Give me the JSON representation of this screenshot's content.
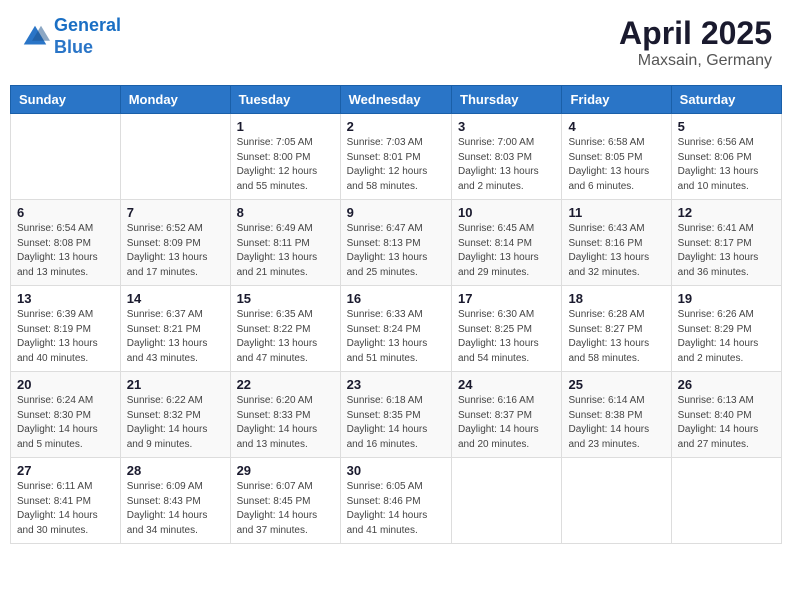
{
  "header": {
    "logo_line1": "General",
    "logo_line2": "Blue",
    "month": "April 2025",
    "location": "Maxsain, Germany"
  },
  "weekdays": [
    "Sunday",
    "Monday",
    "Tuesday",
    "Wednesday",
    "Thursday",
    "Friday",
    "Saturday"
  ],
  "weeks": [
    [
      {
        "day": "",
        "info": ""
      },
      {
        "day": "",
        "info": ""
      },
      {
        "day": "1",
        "info": "Sunrise: 7:05 AM\nSunset: 8:00 PM\nDaylight: 12 hours\nand 55 minutes."
      },
      {
        "day": "2",
        "info": "Sunrise: 7:03 AM\nSunset: 8:01 PM\nDaylight: 12 hours\nand 58 minutes."
      },
      {
        "day": "3",
        "info": "Sunrise: 7:00 AM\nSunset: 8:03 PM\nDaylight: 13 hours\nand 2 minutes."
      },
      {
        "day": "4",
        "info": "Sunrise: 6:58 AM\nSunset: 8:05 PM\nDaylight: 13 hours\nand 6 minutes."
      },
      {
        "day": "5",
        "info": "Sunrise: 6:56 AM\nSunset: 8:06 PM\nDaylight: 13 hours\nand 10 minutes."
      }
    ],
    [
      {
        "day": "6",
        "info": "Sunrise: 6:54 AM\nSunset: 8:08 PM\nDaylight: 13 hours\nand 13 minutes."
      },
      {
        "day": "7",
        "info": "Sunrise: 6:52 AM\nSunset: 8:09 PM\nDaylight: 13 hours\nand 17 minutes."
      },
      {
        "day": "8",
        "info": "Sunrise: 6:49 AM\nSunset: 8:11 PM\nDaylight: 13 hours\nand 21 minutes."
      },
      {
        "day": "9",
        "info": "Sunrise: 6:47 AM\nSunset: 8:13 PM\nDaylight: 13 hours\nand 25 minutes."
      },
      {
        "day": "10",
        "info": "Sunrise: 6:45 AM\nSunset: 8:14 PM\nDaylight: 13 hours\nand 29 minutes."
      },
      {
        "day": "11",
        "info": "Sunrise: 6:43 AM\nSunset: 8:16 PM\nDaylight: 13 hours\nand 32 minutes."
      },
      {
        "day": "12",
        "info": "Sunrise: 6:41 AM\nSunset: 8:17 PM\nDaylight: 13 hours\nand 36 minutes."
      }
    ],
    [
      {
        "day": "13",
        "info": "Sunrise: 6:39 AM\nSunset: 8:19 PM\nDaylight: 13 hours\nand 40 minutes."
      },
      {
        "day": "14",
        "info": "Sunrise: 6:37 AM\nSunset: 8:21 PM\nDaylight: 13 hours\nand 43 minutes."
      },
      {
        "day": "15",
        "info": "Sunrise: 6:35 AM\nSunset: 8:22 PM\nDaylight: 13 hours\nand 47 minutes."
      },
      {
        "day": "16",
        "info": "Sunrise: 6:33 AM\nSunset: 8:24 PM\nDaylight: 13 hours\nand 51 minutes."
      },
      {
        "day": "17",
        "info": "Sunrise: 6:30 AM\nSunset: 8:25 PM\nDaylight: 13 hours\nand 54 minutes."
      },
      {
        "day": "18",
        "info": "Sunrise: 6:28 AM\nSunset: 8:27 PM\nDaylight: 13 hours\nand 58 minutes."
      },
      {
        "day": "19",
        "info": "Sunrise: 6:26 AM\nSunset: 8:29 PM\nDaylight: 14 hours\nand 2 minutes."
      }
    ],
    [
      {
        "day": "20",
        "info": "Sunrise: 6:24 AM\nSunset: 8:30 PM\nDaylight: 14 hours\nand 5 minutes."
      },
      {
        "day": "21",
        "info": "Sunrise: 6:22 AM\nSunset: 8:32 PM\nDaylight: 14 hours\nand 9 minutes."
      },
      {
        "day": "22",
        "info": "Sunrise: 6:20 AM\nSunset: 8:33 PM\nDaylight: 14 hours\nand 13 minutes."
      },
      {
        "day": "23",
        "info": "Sunrise: 6:18 AM\nSunset: 8:35 PM\nDaylight: 14 hours\nand 16 minutes."
      },
      {
        "day": "24",
        "info": "Sunrise: 6:16 AM\nSunset: 8:37 PM\nDaylight: 14 hours\nand 20 minutes."
      },
      {
        "day": "25",
        "info": "Sunrise: 6:14 AM\nSunset: 8:38 PM\nDaylight: 14 hours\nand 23 minutes."
      },
      {
        "day": "26",
        "info": "Sunrise: 6:13 AM\nSunset: 8:40 PM\nDaylight: 14 hours\nand 27 minutes."
      }
    ],
    [
      {
        "day": "27",
        "info": "Sunrise: 6:11 AM\nSunset: 8:41 PM\nDaylight: 14 hours\nand 30 minutes."
      },
      {
        "day": "28",
        "info": "Sunrise: 6:09 AM\nSunset: 8:43 PM\nDaylight: 14 hours\nand 34 minutes."
      },
      {
        "day": "29",
        "info": "Sunrise: 6:07 AM\nSunset: 8:45 PM\nDaylight: 14 hours\nand 37 minutes."
      },
      {
        "day": "30",
        "info": "Sunrise: 6:05 AM\nSunset: 8:46 PM\nDaylight: 14 hours\nand 41 minutes."
      },
      {
        "day": "",
        "info": ""
      },
      {
        "day": "",
        "info": ""
      },
      {
        "day": "",
        "info": ""
      }
    ]
  ]
}
